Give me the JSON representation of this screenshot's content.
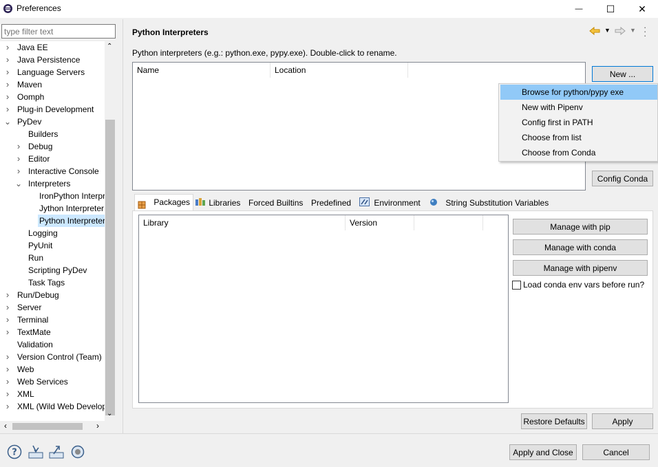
{
  "window": {
    "title": "Preferences",
    "icon": "eclipse-icon",
    "buttons": {
      "minimize": "—",
      "maximize": "☐",
      "close": "✕"
    }
  },
  "filter": {
    "placeholder": "type filter text"
  },
  "tree": [
    {
      "label": "Java EE",
      "level": 0,
      "expander": "collapsed"
    },
    {
      "label": "Java Persistence",
      "level": 0,
      "expander": "collapsed"
    },
    {
      "label": "Language Servers",
      "level": 0,
      "expander": "collapsed"
    },
    {
      "label": "Maven",
      "level": 0,
      "expander": "collapsed"
    },
    {
      "label": "Oomph",
      "level": 0,
      "expander": "collapsed"
    },
    {
      "label": "Plug-in Development",
      "level": 0,
      "expander": "collapsed"
    },
    {
      "label": "PyDev",
      "level": 0,
      "expander": "expanded"
    },
    {
      "label": "Builders",
      "level": 1,
      "expander": "none"
    },
    {
      "label": "Debug",
      "level": 1,
      "expander": "collapsed"
    },
    {
      "label": "Editor",
      "level": 1,
      "expander": "collapsed"
    },
    {
      "label": "Interactive Console",
      "level": 1,
      "expander": "collapsed"
    },
    {
      "label": "Interpreters",
      "level": 1,
      "expander": "expanded"
    },
    {
      "label": "IronPython Interpreter",
      "level": 2,
      "expander": "none"
    },
    {
      "label": "Jython Interpreter",
      "level": 2,
      "expander": "none"
    },
    {
      "label": "Python Interpreter",
      "level": 2,
      "expander": "none",
      "selected": true
    },
    {
      "label": "Logging",
      "level": 1,
      "expander": "none"
    },
    {
      "label": "PyUnit",
      "level": 1,
      "expander": "none"
    },
    {
      "label": "Run",
      "level": 1,
      "expander": "none"
    },
    {
      "label": "Scripting PyDev",
      "level": 1,
      "expander": "none"
    },
    {
      "label": "Task Tags",
      "level": 1,
      "expander": "none"
    },
    {
      "label": "Run/Debug",
      "level": 0,
      "expander": "collapsed"
    },
    {
      "label": "Server",
      "level": 0,
      "expander": "collapsed"
    },
    {
      "label": "Terminal",
      "level": 0,
      "expander": "collapsed"
    },
    {
      "label": "TextMate",
      "level": 0,
      "expander": "collapsed"
    },
    {
      "label": "Validation",
      "level": 0,
      "expander": "none"
    },
    {
      "label": "Version Control (Team)",
      "level": 0,
      "expander": "collapsed"
    },
    {
      "label": "Web",
      "level": 0,
      "expander": "collapsed"
    },
    {
      "label": "Web Services",
      "level": 0,
      "expander": "collapsed"
    },
    {
      "label": "XML",
      "level": 0,
      "expander": "collapsed"
    },
    {
      "label": "XML (Wild Web Developer)",
      "level": 0,
      "expander": "collapsed"
    }
  ],
  "page": {
    "title": "Python Interpreters",
    "description": "Python interpreters (e.g.: python.exe, pypy.exe).   Double-click to rename.",
    "interp_columns": [
      "Name",
      "Location"
    ],
    "new_button": "New ...",
    "config_conda_button": "Config Conda",
    "menu": [
      {
        "label": "Browse for python/pypy exe",
        "highlighted": true
      },
      {
        "label": "New with Pipenv"
      },
      {
        "label": "Config first in PATH"
      },
      {
        "label": "Choose from list"
      },
      {
        "label": "Choose from Conda"
      }
    ],
    "tabs": [
      {
        "label": "Packages",
        "icon": "package-icon",
        "active": true
      },
      {
        "label": "Libraries",
        "icon": "libraries-icon"
      },
      {
        "label": "Forced Builtins",
        "icon": ""
      },
      {
        "label": "Predefined",
        "icon": ""
      },
      {
        "label": "Environment",
        "icon": "environment-icon"
      },
      {
        "label": "String Substitution Variables",
        "icon": "variables-icon"
      }
    ],
    "lib_columns": [
      "Library",
      "Version"
    ],
    "manage_pip": "Manage with pip",
    "manage_conda": "Manage with conda",
    "manage_pipenv": "Manage with pipenv",
    "conda_env_checkbox": "Load conda env vars before run?",
    "conda_env_checked": false,
    "restore_defaults": "Restore Defaults",
    "apply": "Apply"
  },
  "footer": {
    "apply_close": "Apply and Close",
    "cancel": "Cancel",
    "icons": [
      "help-icon",
      "import-icon",
      "export-icon",
      "record-icon"
    ]
  },
  "colors": {
    "selection": "#cce8ff",
    "menu_highlight": "#91c9f7",
    "focus_border": "#0078d7"
  }
}
